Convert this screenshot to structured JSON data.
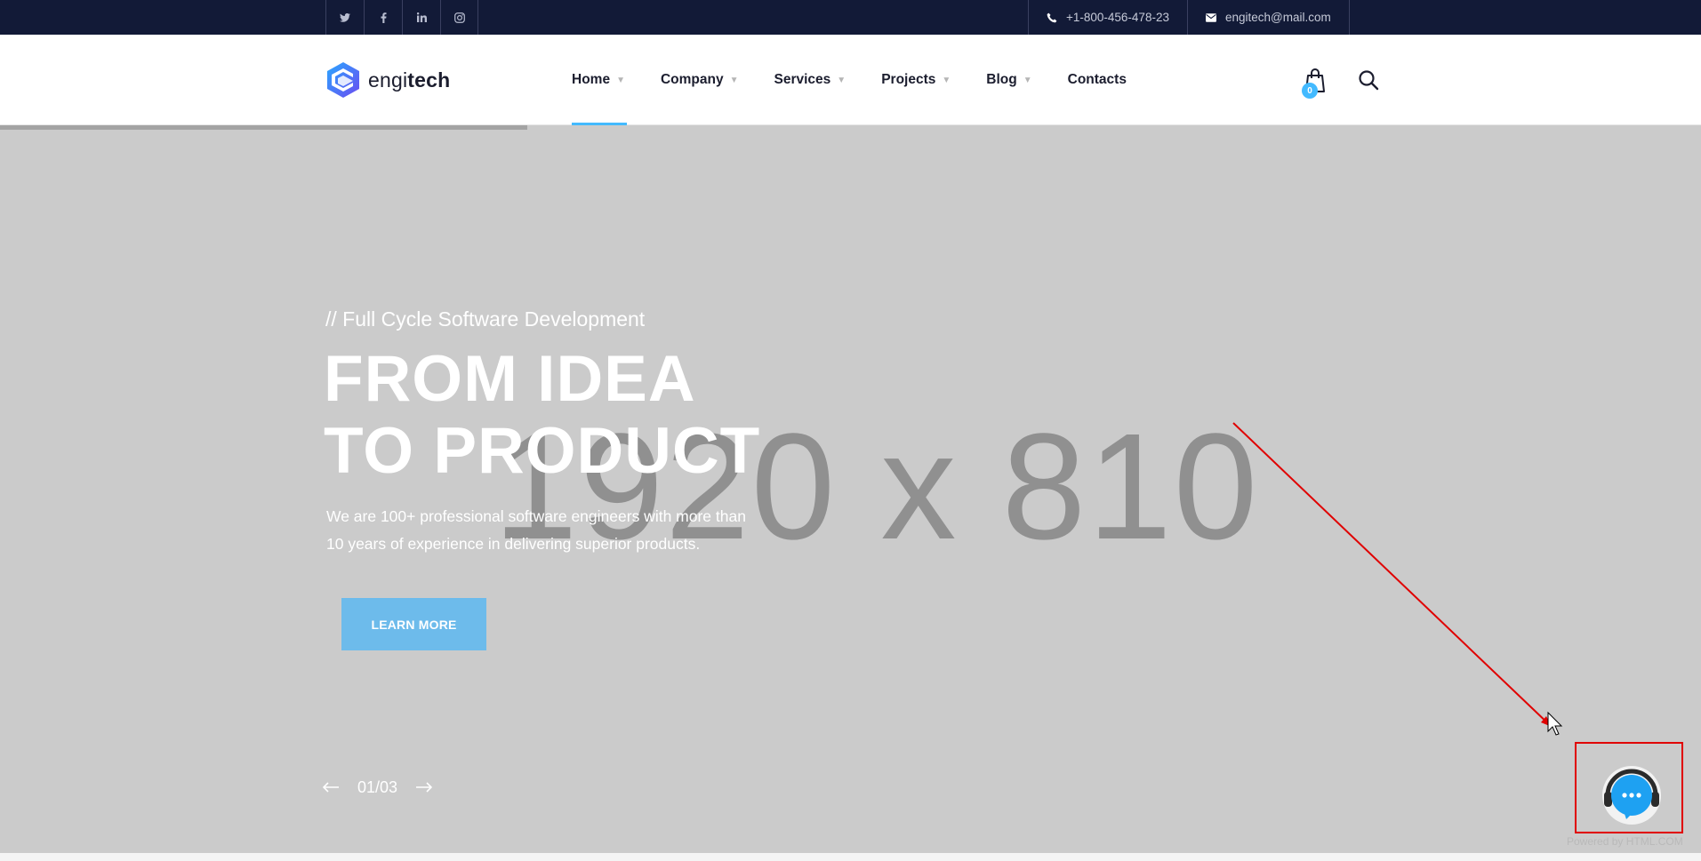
{
  "topbar": {
    "social": [
      {
        "name": "twitter-icon",
        "glyph": "🐦"
      },
      {
        "name": "facebook-icon",
        "glyph": "f"
      },
      {
        "name": "linkedin-icon",
        "glyph": "in"
      },
      {
        "name": "instagram-icon",
        "glyph": "◎"
      }
    ],
    "phone": "+1-800-456-478-23",
    "email": "engitech@mail.com"
  },
  "header": {
    "logo": {
      "prefix": "engi",
      "bold": "tech"
    },
    "nav": [
      {
        "label": "Home",
        "dropdown": true,
        "active": true
      },
      {
        "label": "Company",
        "dropdown": true,
        "active": false
      },
      {
        "label": "Services",
        "dropdown": true,
        "active": false
      },
      {
        "label": "Projects",
        "dropdown": true,
        "active": false
      },
      {
        "label": "Blog",
        "dropdown": true,
        "active": false
      },
      {
        "label": "Contacts",
        "dropdown": false,
        "active": false
      }
    ],
    "cart_count": "0"
  },
  "hero": {
    "placeholder": "1920 x 810",
    "subtitle": "// Full Cycle Software Development",
    "title_line1": "FROM IDEA",
    "title_line2": "TO PRODUCT",
    "desc_line1": "We are 100+ professional software engineers with more than",
    "desc_line2": "10 years of experience in delivering superior products.",
    "button": "LEARN MORE",
    "slide_counter": "01/03"
  },
  "chat": {
    "powered_by": "Powered by HTML.COM"
  },
  "colors": {
    "accent": "#43baff",
    "topbar_bg": "#121a37",
    "hero_bg": "#cbcbcb",
    "button_bg": "#6dbbeb",
    "annotation": "#e00000"
  }
}
